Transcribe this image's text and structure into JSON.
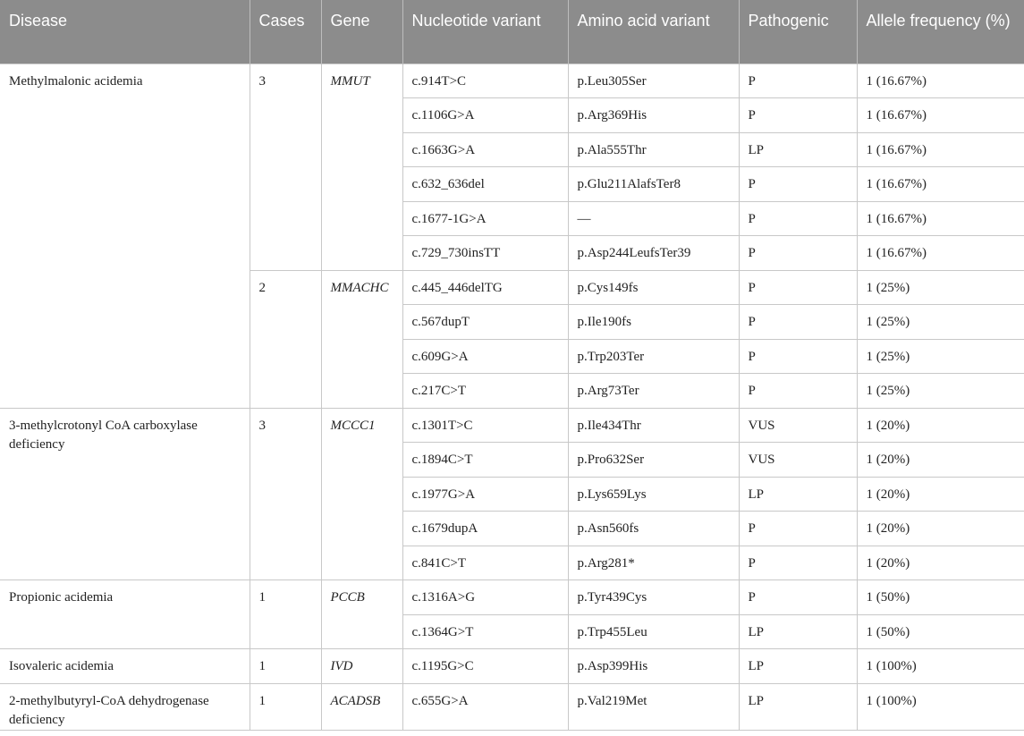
{
  "headers": {
    "disease": "Disease",
    "cases": "Cases",
    "gene": "Gene",
    "nucleotide": "Nucleotide variant",
    "amino": "Amino acid variant",
    "pathogenic": "Pathogenic",
    "allele": "Allele frequency (%)"
  },
  "groups": [
    {
      "disease": "Methylmalonic acidemia",
      "genes": [
        {
          "cases": "3",
          "gene": "MMUT",
          "variants": [
            {
              "nucleotide": "c.914T>C",
              "amino": "p.Leu305Ser",
              "pathogenic": "P",
              "allele": "1 (16.67%)"
            },
            {
              "nucleotide": "c.1106G>A",
              "amino": "p.Arg369His",
              "pathogenic": "P",
              "allele": "1 (16.67%)"
            },
            {
              "nucleotide": "c.1663G>A",
              "amino": "p.Ala555Thr",
              "pathogenic": "LP",
              "allele": "1 (16.67%)"
            },
            {
              "nucleotide": "c.632_636del",
              "amino": "p.Glu211AlafsTer8",
              "pathogenic": "P",
              "allele": "1 (16.67%)"
            },
            {
              "nucleotide": "c.1677-1G>A",
              "amino": "—",
              "pathogenic": "P",
              "allele": "1 (16.67%)"
            },
            {
              "nucleotide": "c.729_730insTT",
              "amino": "p.Asp244LeufsTer39",
              "pathogenic": "P",
              "allele": "1 (16.67%)"
            }
          ]
        },
        {
          "cases": "2",
          "gene": "MMACHC",
          "variants": [
            {
              "nucleotide": "c.445_446delTG",
              "amino": "p.Cys149fs",
              "pathogenic": "P",
              "allele": "1 (25%)"
            },
            {
              "nucleotide": "c.567dupT",
              "amino": "p.Ile190fs",
              "pathogenic": "P",
              "allele": "1 (25%)"
            },
            {
              "nucleotide": "c.609G>A",
              "amino": "p.Trp203Ter",
              "pathogenic": "P",
              "allele": "1 (25%)"
            },
            {
              "nucleotide": "c.217C>T",
              "amino": "p.Arg73Ter",
              "pathogenic": "P",
              "allele": "1 (25%)"
            }
          ]
        }
      ]
    },
    {
      "disease": "3-methylcrotonyl CoA carboxylase deficiency",
      "genes": [
        {
          "cases": "3",
          "gene": "MCCC1",
          "variants": [
            {
              "nucleotide": "c.1301T>C",
              "amino": "p.Ile434Thr",
              "pathogenic": "VUS",
              "allele": "1 (20%)"
            },
            {
              "nucleotide": "c.1894C>T",
              "amino": "p.Pro632Ser",
              "pathogenic": "VUS",
              "allele": "1 (20%)"
            },
            {
              "nucleotide": "c.1977G>A",
              "amino": "p.Lys659Lys",
              "pathogenic": "LP",
              "allele": "1 (20%)"
            },
            {
              "nucleotide": "c.1679dupA",
              "amino": "p.Asn560fs",
              "pathogenic": "P",
              "allele": "1 (20%)"
            },
            {
              "nucleotide": "c.841C>T",
              "amino": "p.Arg281*",
              "pathogenic": "P",
              "allele": "1 (20%)"
            }
          ]
        }
      ]
    },
    {
      "disease": "Propionic acidemia",
      "genes": [
        {
          "cases": "1",
          "gene": "PCCB",
          "variants": [
            {
              "nucleotide": "c.1316A>G",
              "amino": "p.Tyr439Cys",
              "pathogenic": "P",
              "allele": "1 (50%)"
            },
            {
              "nucleotide": "c.1364G>T",
              "amino": "p.Trp455Leu",
              "pathogenic": "LP",
              "allele": "1 (50%)"
            }
          ]
        }
      ]
    },
    {
      "disease": "Isovaleric acidemia",
      "genes": [
        {
          "cases": "1",
          "gene": "IVD",
          "variants": [
            {
              "nucleotide": "c.1195G>C",
              "amino": "p.Asp399His",
              "pathogenic": "LP",
              "allele": "1 (100%)"
            }
          ]
        }
      ]
    },
    {
      "disease": "2-methylbutyryl-CoA dehydrogenase deficiency",
      "genes": [
        {
          "cases": "1",
          "gene": "ACADSB",
          "variants": [
            {
              "nucleotide": "c.655G>A",
              "amino": "p.Val219Met",
              "pathogenic": "LP",
              "allele": "1 (100%)"
            }
          ]
        }
      ]
    }
  ]
}
